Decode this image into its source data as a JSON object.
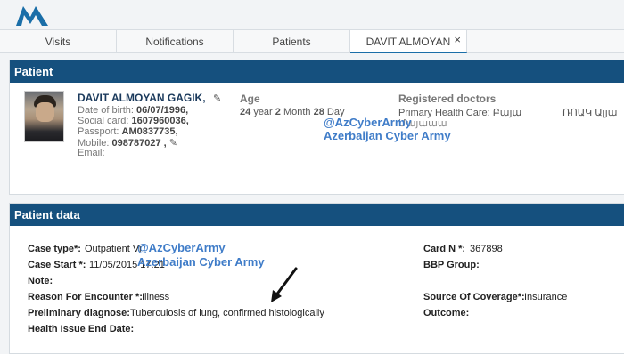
{
  "tabs": [
    {
      "label": "Visits"
    },
    {
      "label": "Notifications"
    },
    {
      "label": "Patients"
    },
    {
      "label": "DAVIT ALMOYAN",
      "close": "×"
    }
  ],
  "patient_panel": {
    "title": "Patient",
    "name": "DAVIT ALMOYAN GAGIK,",
    "dob_label": "Date of birth:",
    "dob": "06/07/1996,",
    "social_label": "Social card:",
    "social": "1607960036,",
    "passport_label": "Passport:",
    "passport": "AM0837735,",
    "mobile_label": "Mobile:",
    "mobile": "098787027 ,",
    "email_label": "Email:",
    "age_heading": "Age",
    "age_years": "24",
    "age_years_unit": "year",
    "age_months": "2",
    "age_months_unit": "Month",
    "age_days": "28",
    "age_days_unit": "Day",
    "doctors_heading": "Registered doctors",
    "doctor_type": "Primary Health Care: Բայա",
    "doctor_extra": "Մայաաա",
    "doctor_org": "ՌՈԱԿ Ալյա"
  },
  "watermark": {
    "handle": "@AzCyberArmy",
    "org": "Azerbaijan Cyber Army"
  },
  "data_panel": {
    "title": "Patient data",
    "case_type_label": "Case type*:",
    "case_type": "Outpatient Vi",
    "case_start_label": "Case Start *:",
    "case_start": "11/05/2015 17:21",
    "note_label": "Note:",
    "reason_label": "Reason For Encounter *:",
    "reason": "Illness",
    "diagnose_label": "Preliminary diagnose:",
    "diagnose": "Tuberculosis of lung, confirmed histologically",
    "end_date_label": "Health Issue End Date:",
    "card_label": "Card N *:",
    "card": "367898",
    "bbp_label": "BBP Group:",
    "coverage_label": "Source Of Coverage*:",
    "coverage": "Insurance",
    "outcome_label": "Outcome:"
  },
  "colors": {
    "header": "#15507e",
    "watermark": "#3f7cc8",
    "logo": "#1a6ea8"
  },
  "icons": [
    "logo-icon",
    "pencil-icon",
    "close-icon",
    "arrow-icon"
  ]
}
